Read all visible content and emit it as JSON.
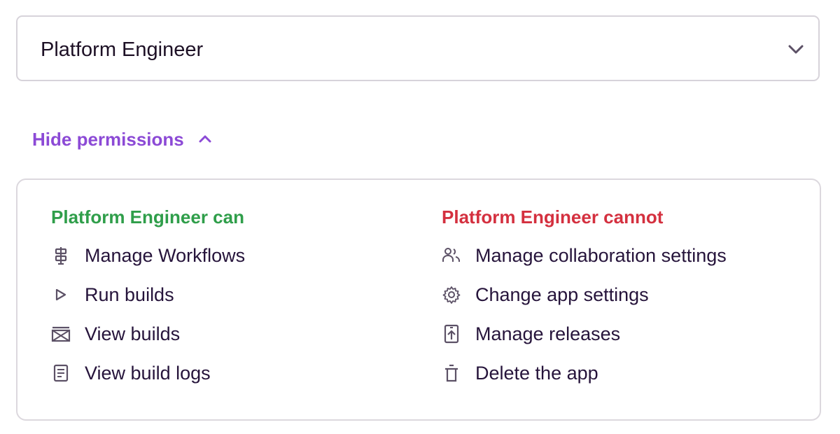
{
  "role_select": {
    "value": "Platform Engineer",
    "icon": "chevron-down-icon"
  },
  "permissions_toggle": {
    "label": "Hide permissions",
    "icon": "chevron-up-icon",
    "color": "#8c4ad6"
  },
  "permissions": {
    "can": {
      "heading": "Platform Engineer can",
      "color": "#2f9e4a",
      "items": [
        {
          "label": "Manage Workflows",
          "icon": "workflow-icon"
        },
        {
          "label": "Run builds",
          "icon": "play-icon"
        },
        {
          "label": "View builds",
          "icon": "builds-icon"
        },
        {
          "label": "View build logs",
          "icon": "document-icon"
        }
      ]
    },
    "cannot": {
      "heading": "Platform Engineer cannot",
      "color": "#d4303f",
      "items": [
        {
          "label": "Manage collaboration settings",
          "icon": "people-icon"
        },
        {
          "label": "Change app settings",
          "icon": "gear-icon"
        },
        {
          "label": "Manage releases",
          "icon": "release-icon"
        },
        {
          "label": "Delete the app",
          "icon": "trash-icon"
        }
      ]
    }
  }
}
